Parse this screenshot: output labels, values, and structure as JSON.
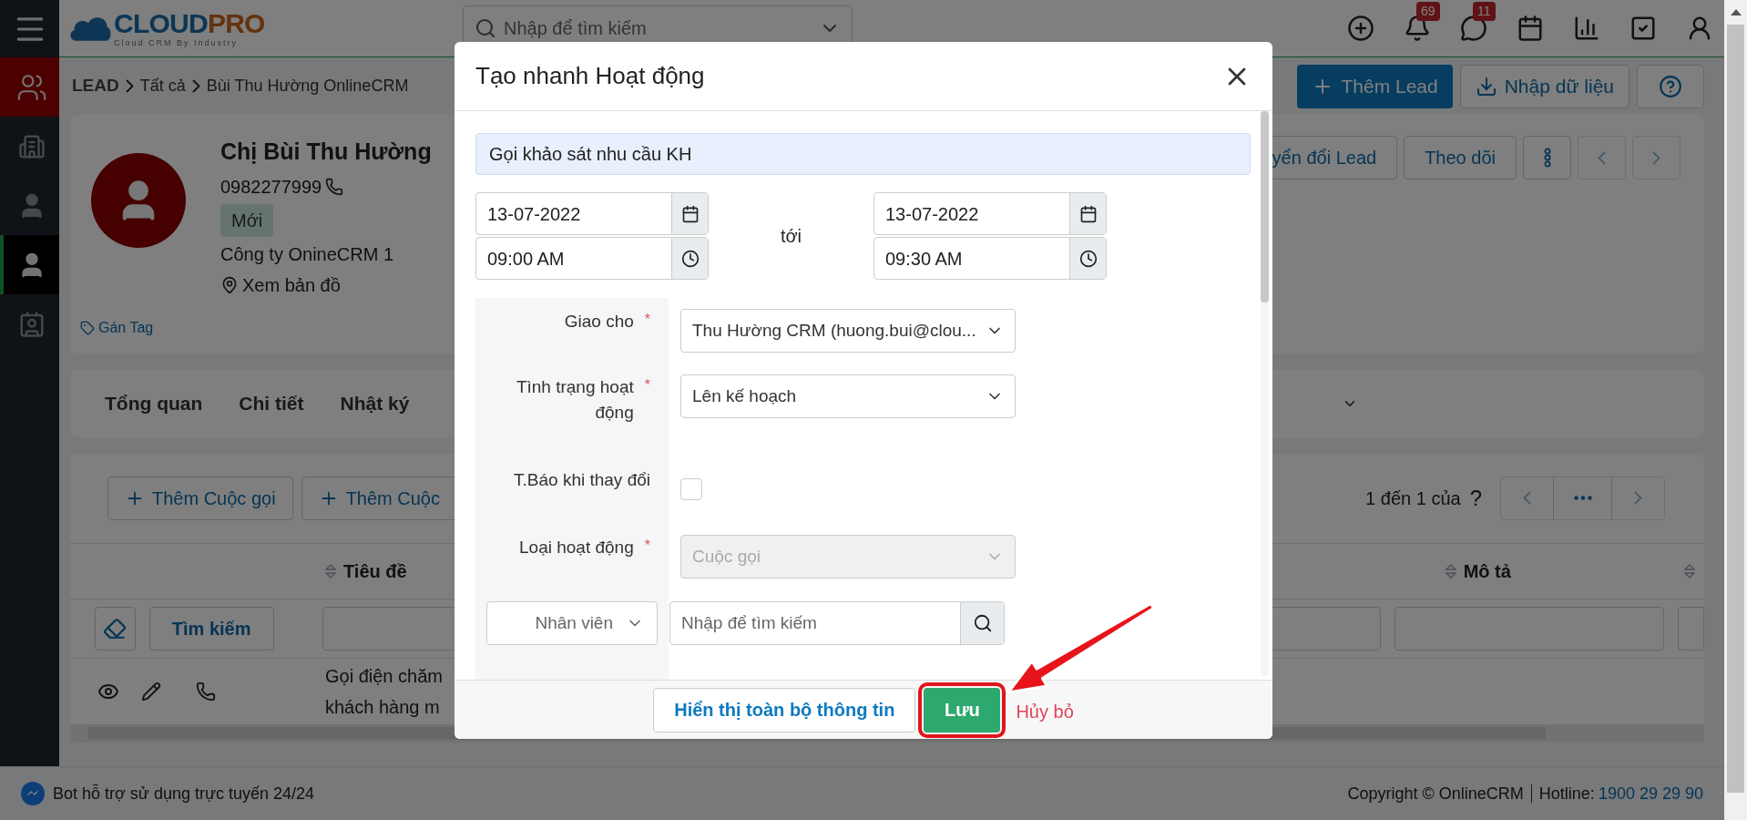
{
  "logo": {
    "parts": [
      "CLOUD",
      "PRO"
    ],
    "tagline": "Cloud CRM By Industry"
  },
  "sidebar": {
    "items": [
      {
        "kind": "module",
        "selected": false
      },
      {
        "kind": "building",
        "selected": false
      },
      {
        "kind": "contact",
        "selected": false
      },
      {
        "kind": "lead",
        "selected": true
      },
      {
        "kind": "document",
        "selected": false
      }
    ]
  },
  "header": {
    "search_placeholder": "Nhập để tìm kiếm",
    "notifications_badge": "69",
    "messages_badge": "11"
  },
  "breadcrumb": [
    "LEAD",
    "Tất cả",
    "Bùi Thu Hường OnlineCRM"
  ],
  "page_actions": [
    {
      "kind": "primary",
      "label": "Thêm Lead"
    },
    {
      "kind": "import",
      "label": "Nhập dữ liệu"
    }
  ],
  "lead": {
    "name": "Chị Bùi Thu Hường",
    "phone": "0982277999",
    "status": "Mới",
    "company": "Công ty OnineCRM 1",
    "map_link": "Xem bản đồ",
    "tag_link": "Gán Tag",
    "actions": [
      "yển đổi Lead",
      "Theo dõi"
    ]
  },
  "tabs": [
    {
      "label": "Tổng quan",
      "selected": false
    },
    {
      "label": "Chi tiết",
      "selected": false
    },
    {
      "label": "Nhật ký",
      "selected": false
    }
  ],
  "activities": {
    "add_buttons": [
      "Thêm Cuộc gọi",
      "Thêm Cuộc"
    ],
    "pagination": "1 đến 1 của",
    "pagination_total": "?",
    "columns": [
      "Tiêu đề",
      "Mô tả"
    ],
    "search_button": "Tìm kiếm",
    "rows": [
      {
        "title_lines": [
          "Gọi điện chăm",
          "khách hàng m"
        ]
      }
    ]
  },
  "modal": {
    "title": "Tạo nhanh Hoạt động",
    "required_mark": "*",
    "subject": "Gọi khảo sát nhu cầu KH",
    "start_date": "13-07-2022",
    "start_time": "09:00 AM",
    "to_label": "tới",
    "end_date": "13-07-2022",
    "end_time": "09:30 AM",
    "fields": [
      {
        "kind": "select",
        "label": "Giao cho",
        "required": true,
        "value": "Thu Hường CRM (huong.bui@clou...",
        "disabled": false
      },
      {
        "kind": "select",
        "label": "Tình trạng hoạt động",
        "required": true,
        "value": "Lên kế hoạch",
        "disabled": false
      },
      {
        "kind": "checkbox",
        "label": "T.Báo khi thay đổi",
        "checked": false
      },
      {
        "kind": "select",
        "label": "Loại hoạt động",
        "required": true,
        "value": "Cuộc gọi",
        "disabled": true
      },
      {
        "kind": "search",
        "select": "Nhân viên",
        "placeholder": "Nhập để tìm kiếm"
      }
    ],
    "buttons": {
      "show_all": "Hiển thị toàn bộ thông tin",
      "save": "Lưu",
      "cancel": "Hủy bỏ"
    }
  },
  "footer": {
    "bot_text": "Bot hỗ trợ sử dụng trực tuyến 24/24",
    "copyright": "Copyright © OnlineCRM",
    "hotline_label": "Hotline:",
    "hotline": "1900 29 29 90"
  }
}
